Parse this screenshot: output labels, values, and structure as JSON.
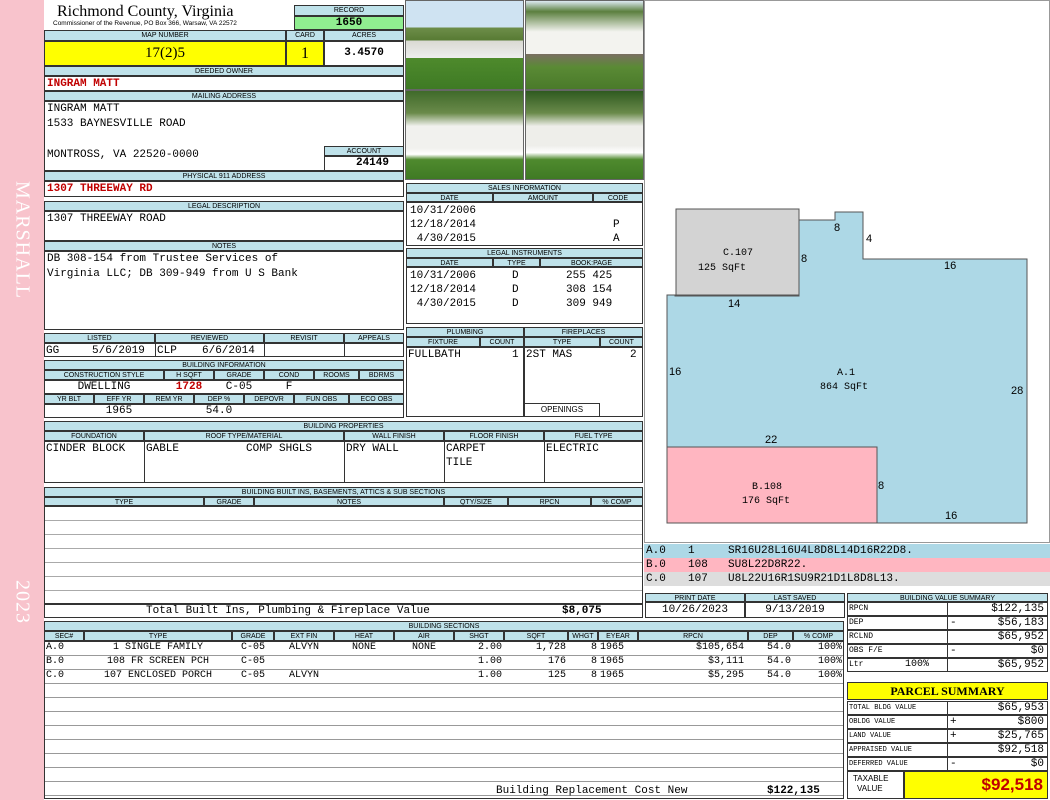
{
  "side": {
    "district": "MARSHALL",
    "year": "2023"
  },
  "header": {
    "county": "Richmond County, Virginia",
    "commissioner": "Commissioner of the Revenue, PO Box 366, Warsaw, VA 22572",
    "record_label": "RECORD",
    "record": "1650",
    "map_label": "MAP NUMBER",
    "map_number": "17(2)5",
    "card_label": "CARD",
    "card": "1",
    "acres_label": "ACRES",
    "acres": "3.4570"
  },
  "owner": {
    "deeded_label": "DEEDED OWNER",
    "deeded": "INGRAM MATT",
    "mailing_label": "MAILING ADDRESS",
    "mail1": "INGRAM MATT",
    "mail2": "1533 BAYNESVILLE ROAD",
    "mail3": "MONTROSS, VA 22520-0000",
    "account_label": "ACCOUNT",
    "account": "24149",
    "physical_label": "PHYSICAL 911 ADDRESS",
    "physical": "1307 THREEWAY RD",
    "legal_label": "LEGAL DESCRIPTION",
    "legal": "1307 THREEWAY ROAD",
    "notes_label": "NOTES",
    "notes1": "DB 308-154 from Trustee Services of",
    "notes2": "Virginia LLC; DB 309-949 from U S Bank"
  },
  "sales": {
    "title": "SALES INFORMATION",
    "headers": [
      "DATE",
      "AMOUNT",
      "CODE"
    ],
    "rows": [
      {
        "date": "10/31/2006",
        "amount": "",
        "code": ""
      },
      {
        "date": "12/18/2014",
        "amount": "",
        "code": "P"
      },
      {
        "date": " 4/30/2015",
        "amount": "",
        "code": "A"
      }
    ]
  },
  "instruments": {
    "title": "LEGAL INSTRUMENTS",
    "headers": [
      "DATE",
      "TYPE",
      "BOOK:PAGE"
    ],
    "rows": [
      {
        "date": "10/31/2006",
        "type": "D",
        "book": "255 425"
      },
      {
        "date": "12/18/2014",
        "type": "D",
        "book": "308 154"
      },
      {
        "date": " 4/30/2015",
        "type": "D",
        "book": "309 949"
      }
    ]
  },
  "listing": {
    "headers": [
      "LISTED",
      "REVIEWED",
      "REVISIT",
      "APPEALS"
    ],
    "listed_by": "GG",
    "listed_date": "5/6/2019",
    "reviewed_by": "CLP",
    "reviewed_date": "6/6/2014"
  },
  "building_info": {
    "title": "BUILDING INFORMATION",
    "headers": [
      "CONSTRUCTION STYLE",
      "H SQFT",
      "GRADE",
      "COND",
      "ROOMS",
      "BDRMS"
    ],
    "style": "DWELLING",
    "hsqft": "1728",
    "grade": "C-05",
    "cond": "F",
    "rooms": "",
    "bdrms": "",
    "headers2": [
      "YR BLT",
      "EFF YR",
      "REM YR",
      "DEP %",
      "DEPOVR",
      "FUN OBS",
      "ECO OBS"
    ],
    "yr_blt": "",
    "eff_yr": "1965",
    "rem_yr": "",
    "dep": "54.0"
  },
  "plumbing": {
    "title": "PLUMBING",
    "headers": [
      "FIXTURE",
      "COUNT"
    ],
    "fixture": "FULLBATH",
    "count": "1"
  },
  "fireplaces": {
    "title": "FIREPLACES",
    "headers": [
      "TYPE",
      "COUNT"
    ],
    "type": "2ST MAS",
    "count": "2",
    "openings": "OPENINGS"
  },
  "properties": {
    "title": "BUILDING PROPERTIES",
    "headers": [
      "FOUNDATION",
      "ROOF TYPE/MATERIAL",
      "WALL FINISH",
      "FLOOR FINISH",
      "FUEL TYPE"
    ],
    "foundation": "CINDER BLOCK",
    "roof_type": "GABLE",
    "roof_material": "COMP SHGLS",
    "wall": "DRY WALL",
    "floor1": "CARPET",
    "floor2": "TILE",
    "fuel": "ELECTRIC"
  },
  "builtins": {
    "title": "BUILDING BUILT INS, BASEMENTS, ATTICS & SUB SECTIONS",
    "headers": [
      "TYPE",
      "GRADE",
      "NOTES",
      "QTY/SIZE",
      "RPCN",
      "% COMP"
    ],
    "total_label": "Total Built Ins, Plumbing & Fireplace Value",
    "total": "$8,075"
  },
  "print": {
    "print_label": "PRINT DATE",
    "print_date": "10/26/2023",
    "saved_label": "LAST SAVED",
    "saved_date": "9/13/2019"
  },
  "sketch": {
    "areas": [
      {
        "name": "C.107",
        "sqft": "125 SqFt"
      },
      {
        "name": "A.1",
        "sqft": "864 SqFt"
      },
      {
        "name": "B.108",
        "sqft": "176 SqFt"
      }
    ],
    "dims": [
      "8",
      "4",
      "8",
      "16",
      "14",
      "16",
      "28",
      "22",
      "8",
      "16"
    ],
    "colors": {
      "A": "#add8e6",
      "B": "#ffb6c1",
      "C": "#d3d3d3"
    },
    "legend": [
      {
        "sec": "A.0",
        "code": "1",
        "path": "SR16U28L16U4L8D8L14D16R22D8."
      },
      {
        "sec": "B.0",
        "code": "108",
        "path": "SU8L22D8R22."
      },
      {
        "sec": "C.0",
        "code": "107",
        "path": "U8L22U16R1SU9R21D1L8D8L13."
      }
    ]
  },
  "sections": {
    "title": "BUILDING SECTIONS",
    "headers": [
      "SEC#",
      "TYPE",
      "GRADE",
      "EXT FIN",
      "HEAT",
      "AIR",
      "SHGT",
      "SQFT",
      "WHGT",
      "EYEAR",
      "RPCN",
      "DEP",
      "% COMP"
    ],
    "rows": [
      {
        "sec": "A.0",
        "type": "1 SINGLE FAMILY",
        "grade": "C-05",
        "ext": "ALVYN",
        "heat": "NONE",
        "air": "NONE",
        "shgt": "2.00",
        "sqft": "1,728",
        "whgt": "8",
        "eyear": "1965",
        "rpcn": "$105,654",
        "dep": "54.0",
        "comp": "100%"
      },
      {
        "sec": "B.0",
        "type": "108 FR SCREEN PCH",
        "grade": "C-05",
        "ext": "",
        "heat": "",
        "air": "",
        "shgt": "1.00",
        "sqft": "176",
        "whgt": "8",
        "eyear": "1965",
        "rpcn": "$3,111",
        "dep": "54.0",
        "comp": "100%"
      },
      {
        "sec": "C.0",
        "type": "107 ENCLOSED PORCH",
        "grade": "C-05",
        "ext": "ALVYN",
        "heat": "",
        "air": "",
        "shgt": "1.00",
        "sqft": "125",
        "whgt": "8",
        "eyear": "1965",
        "rpcn": "$5,295",
        "dep": "54.0",
        "comp": "100%"
      }
    ],
    "brcn_label": "Building Replacement Cost New",
    "brcn": "$122,135"
  },
  "bvs": {
    "title": "BUILDING VALUE SUMMARY",
    "rows": [
      {
        "label": "RPCN",
        "sign": "",
        "pct": "",
        "value": "$122,135"
      },
      {
        "label": "DEP",
        "sign": "-",
        "pct": "",
        "value": "$56,183"
      },
      {
        "label": "RCLND",
        "sign": "",
        "pct": "",
        "value": "$65,952"
      },
      {
        "label": "OBS F/E",
        "sign": "-",
        "pct": "",
        "value": "$0"
      },
      {
        "label": "Ltr",
        "sign": "",
        "pct": "100%",
        "value": "$65,952"
      }
    ]
  },
  "parcel": {
    "title": "PARCEL SUMMARY",
    "rows": [
      {
        "label": "TOTAL BLDG VALUE",
        "sign": "",
        "value": "$65,953"
      },
      {
        "label": "OBLDG VALUE",
        "sign": "+",
        "value": "$800"
      },
      {
        "label": "LAND VALUE",
        "sign": "+",
        "value": "$25,765"
      },
      {
        "label": "APPRAISED VALUE",
        "sign": "",
        "value": "$92,518"
      },
      {
        "label": "DEFERRED VALUE",
        "sign": "-",
        "value": "$0"
      }
    ],
    "taxable_label1": "TAXABLE",
    "taxable_label2": "VALUE",
    "taxable": "$92,518"
  }
}
